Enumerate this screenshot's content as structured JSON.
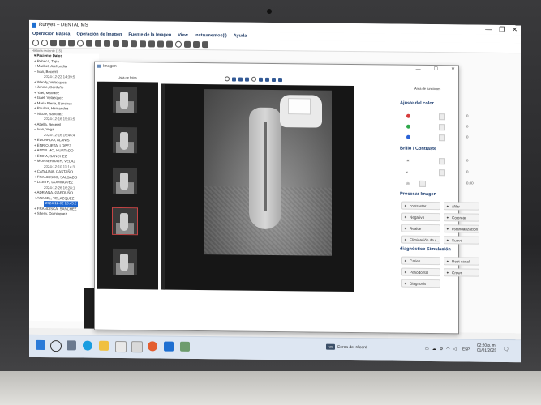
{
  "app": {
    "title": "Runyes – DENTAL MS",
    "window_buttons": [
      "—",
      "❐",
      "✕"
    ]
  },
  "menu": [
    "Operación Básica",
    "Operación de Imagen",
    "Fuente de la Imagen",
    "View",
    "Instrumentos(I)",
    "Ayuda"
  ],
  "history_label": "Historia reciente (15)",
  "tree": {
    "header": "Paciente Datos",
    "nodes": [
      "Rebeca, Tapa",
      "Maribel, Archundia",
      "Ivan, Becerril",
      "Wendy, Velazquez",
      "Jennie, Garduño",
      "Yael, Malvaez",
      "Gael, Velazquez",
      "Maria Elena, Sanchez",
      "Paulina, Hernandez",
      "Nicole, Sanchez",
      "Abella, Becerril",
      "Ivan, Vega",
      "EDUARDO, ALANIS",
      "ENRIQUETA, LOPEZ",
      "ANTELMO, HURTADO",
      "ERIKA, SANCHEZ",
      "MONSERRATH, VELAZ",
      "CATALINA, CASTAÑO",
      "FRANCISCO, SALGADO",
      "LIZETH, DOMINGUEZ",
      "ADRIANA, GARDUÑO",
      "ANABEL, VELAZQUEZ",
      "FRANCISCA, SANCHEZ",
      "Sherly, Dominguez"
    ],
    "dates": [
      "2024-12-22 14:39:5",
      "2024-12-16 15:03:5",
      "2024-12-16 16:46:4",
      "2024-12-10 11:14:3",
      "2024-12-26 16:28:1"
    ],
    "selected_date": "2024-12-02 13:45:2"
  },
  "dialog": {
    "title": "Imagen",
    "window_buttons": [
      "—",
      "☐",
      "✕"
    ],
    "thumbs_title": "Lista de fotos",
    "functions_title": "Área de funciones"
  },
  "panel": {
    "color_section": "Ajuste del color",
    "color_values": [
      "0",
      "0",
      "0"
    ],
    "brightness_section": "Brillo / Contraste",
    "brightness_values": [
      "0",
      "0",
      "0.00"
    ],
    "process_section": "Procesar Imagen",
    "process_buttons": [
      "contrastar",
      "afilar",
      "Negativo",
      "Colorear",
      "Realce",
      "estandarización",
      "Eliminación de r...",
      "Suave"
    ],
    "diagnosis_section": "diagnóstico Simulación",
    "diagnosis_buttons": [
      "Caries",
      "Root canal",
      "Periodontal",
      "Crown",
      "Diagnosis"
    ]
  },
  "taskbar": {
    "notification": "Cerca del récord",
    "notification_badge": "≈20",
    "language": "ESP",
    "time": "02:20 p. m.",
    "date": "01/01/2025"
  },
  "colors": {
    "menu_text": "#1f3b66",
    "selection": "#1e66d0",
    "section_heading": "#1c3d70",
    "red_channel": "#d63c3c",
    "green_channel": "#2fa84b",
    "blue_channel": "#2c63d6"
  }
}
